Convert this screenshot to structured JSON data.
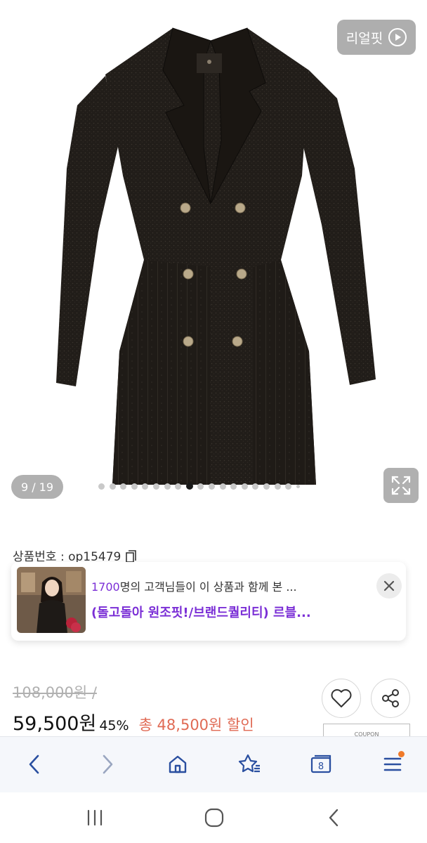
{
  "hero": {
    "realfit_label": "리얼핏",
    "counter": "9 / 19",
    "total_images": 19,
    "current_image": 9
  },
  "product": {
    "number_label": "상품번호 : op15479",
    "original_price": "108,000원 /",
    "price": "59,500원",
    "discount_percent": "45%",
    "total_discount": "총 48,500원 할인",
    "coupon_label": "COUPON"
  },
  "recommendation": {
    "count": "1700",
    "line1_rest": "명의 고객님들이 이 상품과 함께 본 ...",
    "line2": "(돌고돌아 원조핏!/브랜드퀄리티) 르블..."
  },
  "colors": {
    "accent_purple": "#7b2fd6",
    "discount_red": "#e06a54",
    "browser_blue": "#2a4fa0",
    "notification_orange": "#f07a2a"
  },
  "icons": {
    "browser": [
      "back-arrow-icon",
      "forward-arrow-icon",
      "home-icon",
      "bookmark-star-icon",
      "tabs-icon",
      "menu-icon"
    ],
    "tabs_count": "8",
    "system": [
      "recent-apps-icon",
      "home-circle-icon",
      "back-chevron-icon"
    ]
  }
}
